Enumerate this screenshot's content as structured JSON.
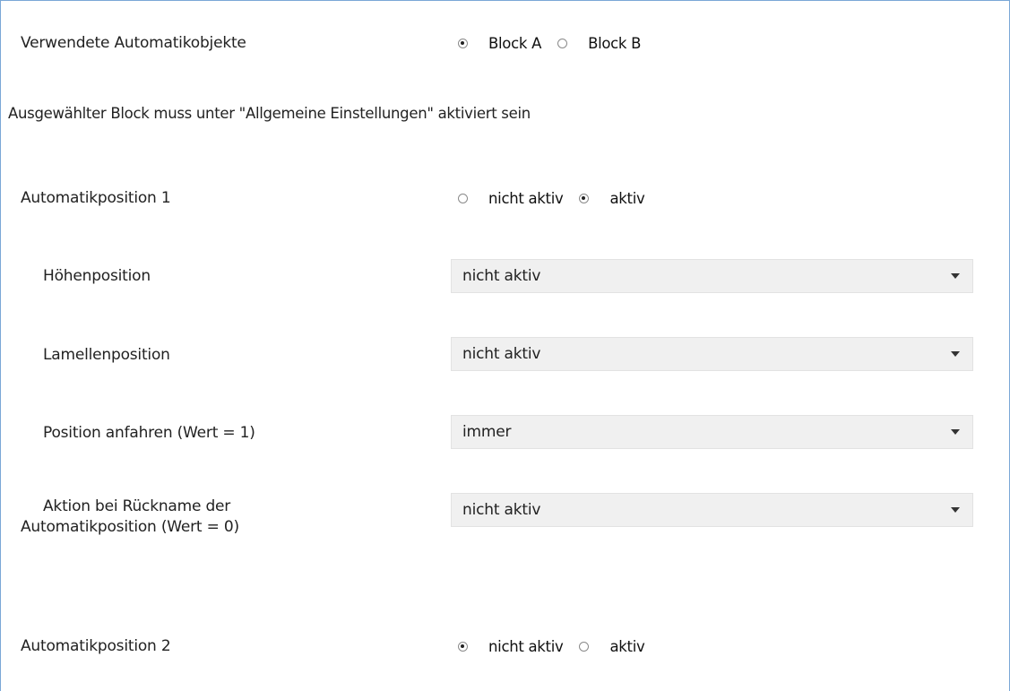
{
  "block_row": {
    "label": "Verwendete Automatikobjekte",
    "options": [
      {
        "label": "Block A",
        "checked": true
      },
      {
        "label": "Block B",
        "checked": false
      }
    ]
  },
  "note": "Ausgewählter Block muss unter \"Allgemeine Einstellungen\" aktiviert sein",
  "pos1": {
    "label": "Automatikposition 1",
    "options": [
      {
        "label": "nicht aktiv",
        "checked": false
      },
      {
        "label": "aktiv",
        "checked": true
      }
    ]
  },
  "settings": [
    {
      "label": "Höhenposition",
      "value": "nicht aktiv"
    },
    {
      "label": "Lamellenposition",
      "value": "nicht aktiv"
    },
    {
      "label": "Position anfahren (Wert = 1)",
      "value": "immer"
    },
    {
      "label_line1": "Aktion bei Rückname der",
      "label_line2": "Automatikposition (Wert = 0)",
      "value": "nicht aktiv"
    }
  ],
  "pos2": {
    "label": "Automatikposition 2",
    "options": [
      {
        "label": "nicht aktiv",
        "checked": true
      },
      {
        "label": "aktiv",
        "checked": false
      }
    ]
  }
}
